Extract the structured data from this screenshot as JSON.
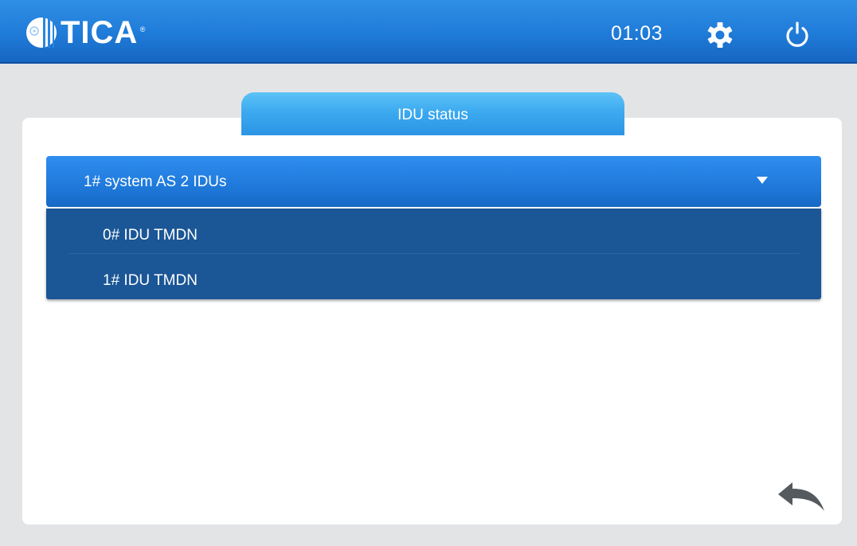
{
  "header": {
    "logo_text": "TICA",
    "logo_reg": "®",
    "time": "01:03",
    "icons": [
      "settings-gear-icon",
      "power-icon"
    ]
  },
  "tab": {
    "label": "IDU status"
  },
  "select": {
    "selected": "1# system AS 2 IDUs",
    "options": [
      "0# IDU TMDN",
      "1# IDU TMDN"
    ]
  },
  "footer": {
    "icons": [
      "back-arrow-icon"
    ]
  },
  "colors": {
    "header_blue": "#1f7bd8",
    "tab_blue": "#3aa8ef",
    "select_blue": "#1f79da",
    "dropdown_blue": "#1b5696",
    "background": "#e3e4e6",
    "panel": "#ffffff"
  }
}
